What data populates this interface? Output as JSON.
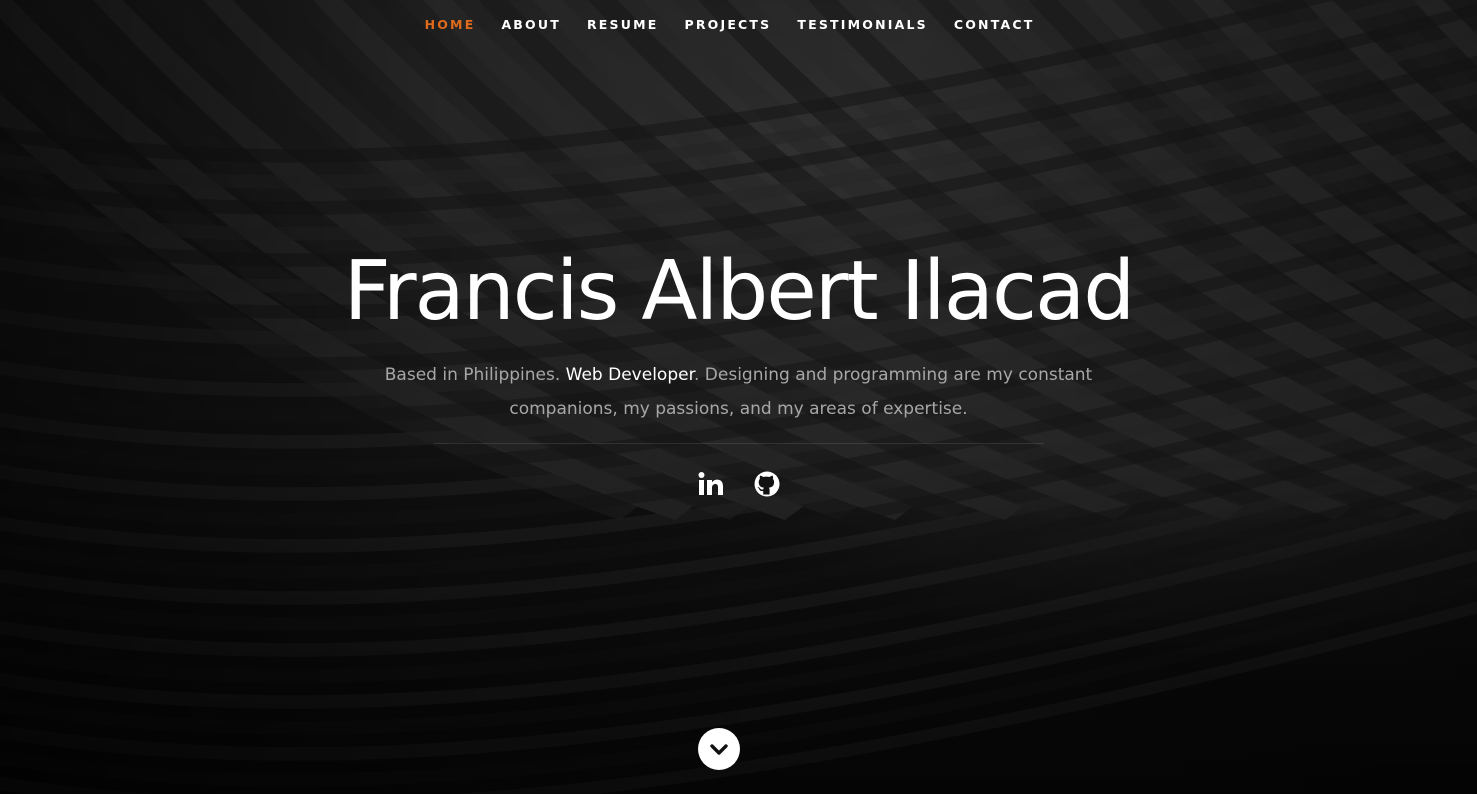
{
  "nav": {
    "items": [
      {
        "label": "HOME",
        "current": true
      },
      {
        "label": "ABOUT",
        "current": false
      },
      {
        "label": "RESUME",
        "current": false
      },
      {
        "label": "PROJECTS",
        "current": false
      },
      {
        "label": "TESTIMONIALS",
        "current": false
      },
      {
        "label": "CONTACT",
        "current": false
      }
    ]
  },
  "banner": {
    "name": "Francis Albert Ilacad",
    "intro_prefix": "Based in Philippines. ",
    "role": "Web Developer",
    "intro_suffix": ". Designing and programming are my constant companions, my passions, and my areas of expertise."
  },
  "social": [
    {
      "icon": "linkedin-icon"
    },
    {
      "icon": "github-icon"
    }
  ],
  "scroll": {
    "icon": "chevron-down-icon"
  },
  "colors": {
    "accent": "#e06a1b",
    "text": "#ffffff",
    "muted": "#a7a7a7",
    "background": "#111111"
  }
}
